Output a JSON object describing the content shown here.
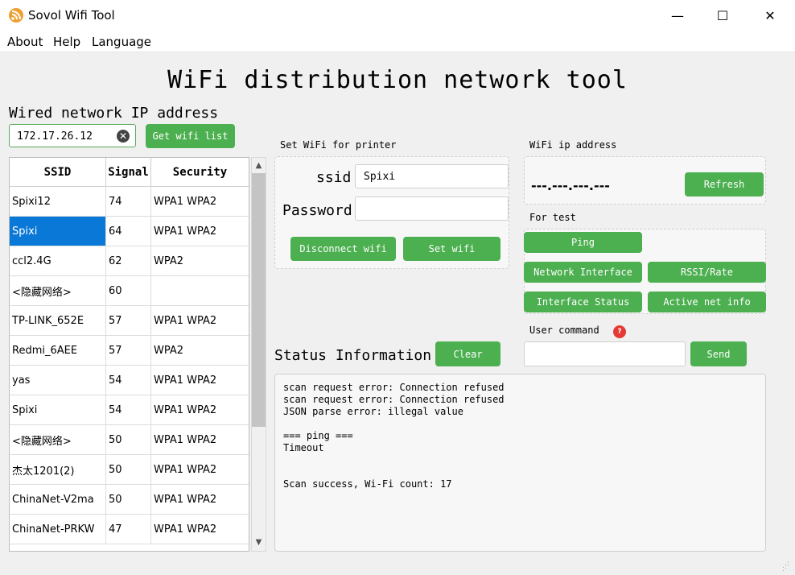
{
  "window": {
    "title": "Sovol Wifi Tool",
    "controls": {
      "minimize": "—",
      "maximize": "☐",
      "close": "✕"
    }
  },
  "menu": {
    "items": [
      "About",
      "Help",
      "Language"
    ]
  },
  "main_title": "WiFi distribution network tool",
  "wired": {
    "label": "Wired network IP address",
    "ip_value": "172.17.26.12",
    "get_list_button": "Get wifi list"
  },
  "wifi_table": {
    "columns": [
      "SSID",
      "Signal",
      "Security"
    ],
    "rows": [
      [
        "Spixi12",
        "74",
        "WPA1 WPA2"
      ],
      [
        "Spixi",
        "64",
        "WPA1 WPA2"
      ],
      [
        "ccl2.4G",
        "62",
        "WPA2"
      ],
      [
        "<隐藏网络>",
        "60",
        ""
      ],
      [
        "TP-LINK_652E",
        "57",
        "WPA1 WPA2"
      ],
      [
        "Redmi_6AEE",
        "57",
        "WPA2"
      ],
      [
        "yas",
        "54",
        "WPA1 WPA2"
      ],
      [
        "Spixi",
        "54",
        "WPA1 WPA2"
      ],
      [
        "<隐藏网络>",
        "50",
        "WPA1 WPA2"
      ],
      [
        "杰太1201(2)",
        "50",
        "WPA1 WPA2"
      ],
      [
        "ChinaNet-V2ma",
        "50",
        "WPA1 WPA2"
      ],
      [
        "ChinaNet-PRKW",
        "47",
        "WPA1 WPA2"
      ]
    ],
    "selected_row": 1
  },
  "set_wifi": {
    "group_title": "Set WiFi for printer",
    "ssid_label": "ssid",
    "ssid_value": "Spixi",
    "password_label": "Password",
    "password_value": "",
    "disconnect_button": "Disconnect wifi",
    "set_button": "Set wifi"
  },
  "wifi_ip": {
    "group_title": "WiFi ip address",
    "value": "---.---.---.---",
    "refresh_button": "Refresh"
  },
  "for_test": {
    "group_title": "For test",
    "ping": "Ping",
    "network_interface": "Network Interface",
    "rssi_rate": "RSSI/Rate",
    "interface_status": "Interface Status",
    "active_net_info": "Active net info"
  },
  "user_command": {
    "label": "User command",
    "help_icon": "?",
    "value": "",
    "send_button": "Send"
  },
  "status": {
    "title": "Status Information",
    "clear_button": "Clear",
    "lines": [
      "scan request error: Connection refused",
      "scan request error: Connection refused",
      "JSON parse error: illegal value",
      "",
      "=== ping ===",
      "Timeout",
      "",
      "",
      "Scan success, Wi-Fi count: 17"
    ]
  },
  "colors": {
    "accent_green": "#4caf50",
    "selection_blue": "#0a78d7"
  }
}
